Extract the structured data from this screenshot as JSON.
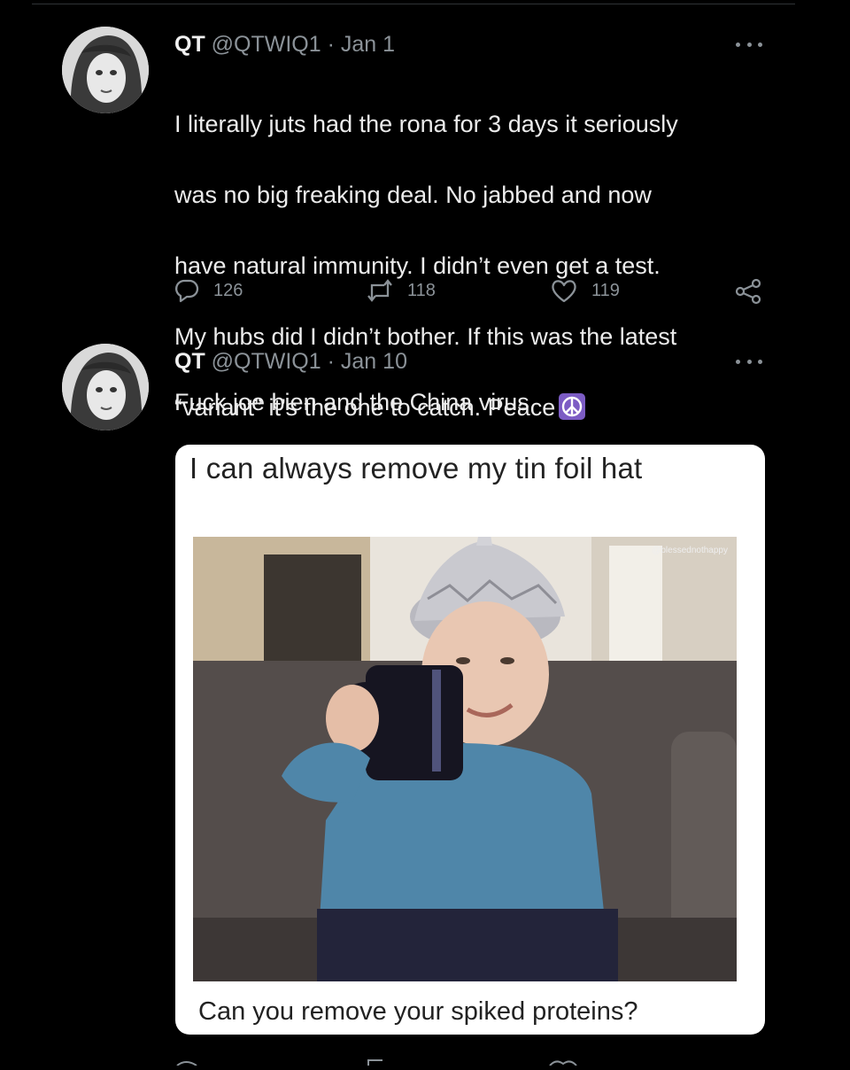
{
  "tweets": [
    {
      "name": "QT",
      "handle": "@QTWIQ1",
      "separator": "·",
      "date": "Jan 1",
      "text_lines": [
        "I literally juts had the rona for 3 days it seriously",
        "was no big freaking deal. No jabbed and now",
        "have natural immunity. I didn’t even get a test.",
        "My hubs did I didn’t bother. If this was the latest",
        "“variant” it’s the one to catch. Peace"
      ],
      "emoji": "peace-symbol-icon",
      "replies": "126",
      "retweets": "118",
      "likes": "119"
    },
    {
      "name": "QT",
      "handle": "@QTWIQ1",
      "separator": "·",
      "date": "Jan 10",
      "text": "Fuck joe bien and the China virus"
    }
  ],
  "meme": {
    "top_caption": "I can always remove my tin foil hat",
    "bottom_caption": "Can you remove your spiked proteins?",
    "watermark": "@blessednothappy"
  },
  "colors": {
    "background": "#000000",
    "text": "#e7e9ea",
    "muted": "#8b9298",
    "emoji_bg": "#7c5cc4"
  }
}
